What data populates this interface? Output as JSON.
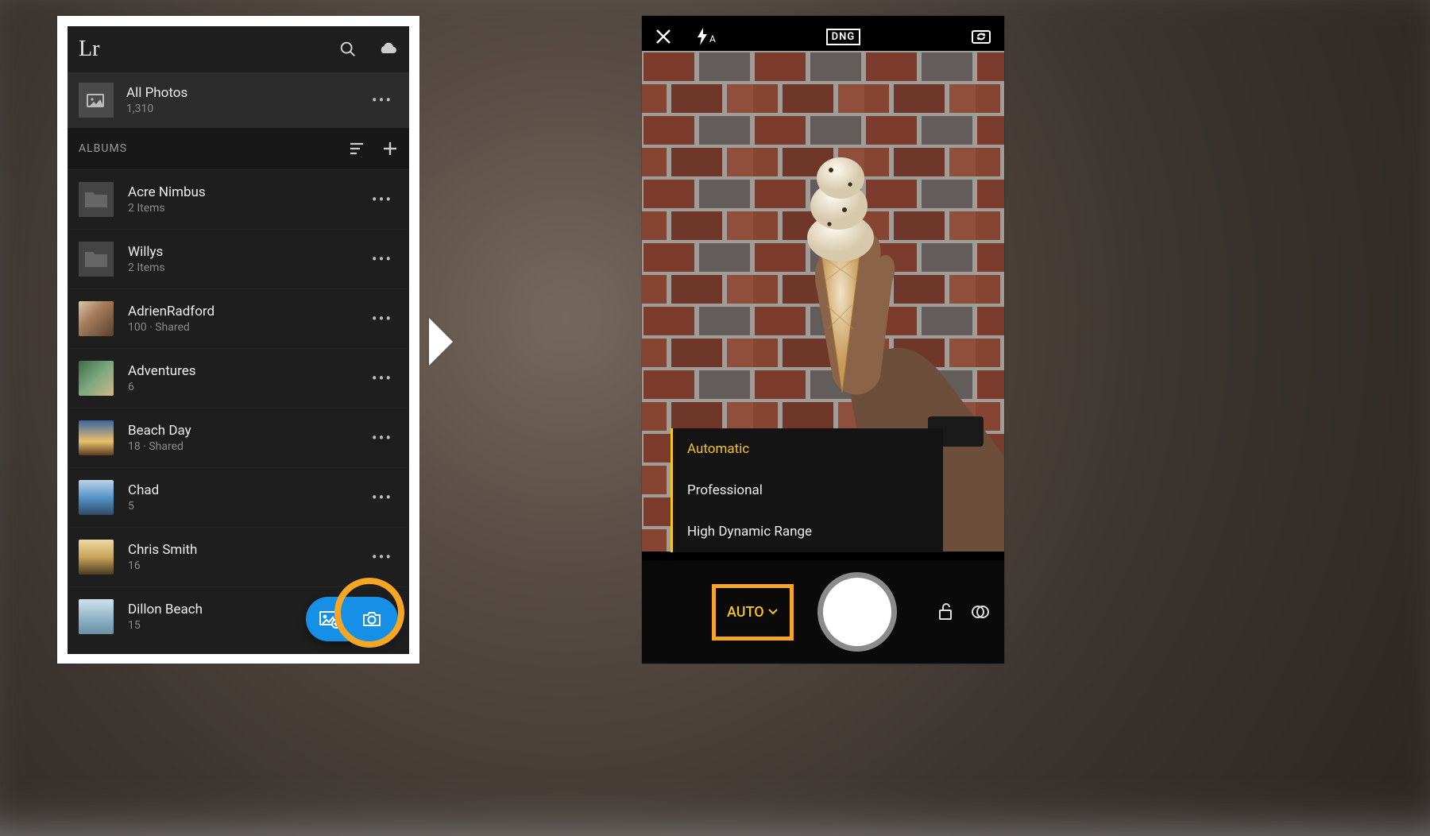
{
  "colors": {
    "highlight": "#f5a623",
    "accent_blue": "#1690e7",
    "accent_yellow": "#f5c518"
  },
  "library": {
    "app_logo": "Lr",
    "all_photos": {
      "title": "All Photos",
      "count": "1,310"
    },
    "section_label": "ALBUMS",
    "folders": [
      {
        "name": "Acre Nimbus",
        "sub": "2 Items"
      },
      {
        "name": "Willys",
        "sub": "2 Items"
      }
    ],
    "albums": [
      {
        "name": "AdrienRadford",
        "sub": "100 · Shared"
      },
      {
        "name": "Adventures",
        "sub": "6"
      },
      {
        "name": "Beach Day",
        "sub": "18 · Shared"
      },
      {
        "name": "Chad",
        "sub": "5"
      },
      {
        "name": "Chris Smith",
        "sub": "16"
      },
      {
        "name": "Dillon Beach",
        "sub": "15"
      }
    ],
    "more_dots": "•••"
  },
  "camera": {
    "format_badge": "DNG",
    "flash_mode": "A",
    "modes": [
      {
        "label": "Automatic",
        "selected": true
      },
      {
        "label": "Professional",
        "selected": false
      },
      {
        "label": "High Dynamic Range",
        "selected": false
      }
    ],
    "mode_button_label": "AUTO"
  }
}
